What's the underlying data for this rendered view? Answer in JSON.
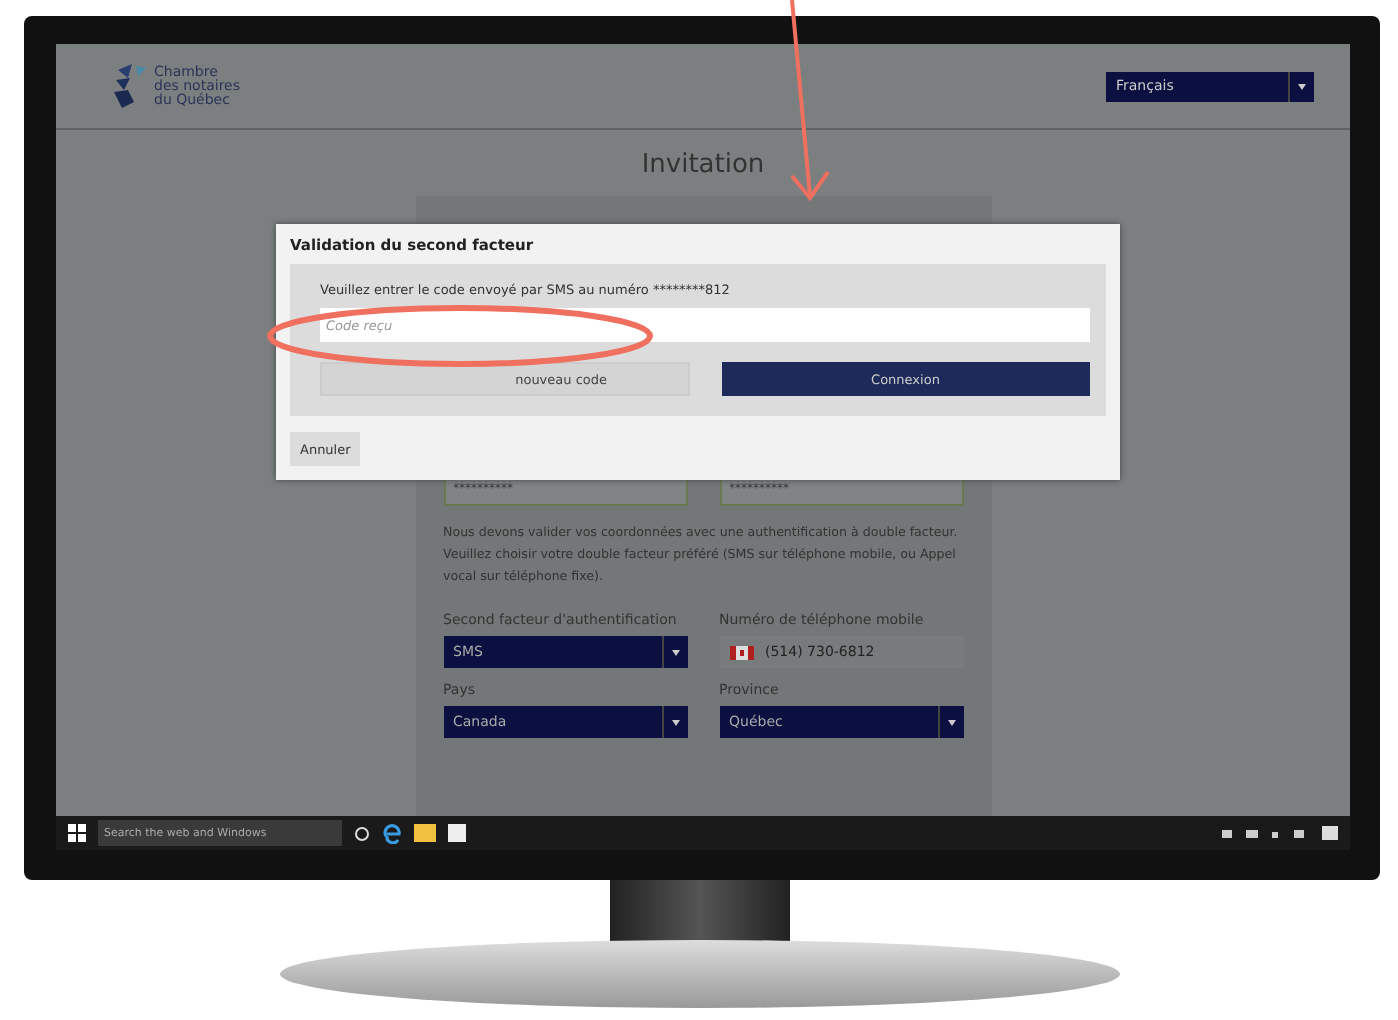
{
  "header": {
    "logo_lines": [
      "Chambre",
      "des notaires",
      "du Québec"
    ],
    "language": "Français"
  },
  "title": "Invitation",
  "form": {
    "passwords": [
      "**********",
      "**********"
    ],
    "notice": "Nous devons valider vos coordonnées avec une authentification à double facteur. Veuillez choisir votre double facteur préféré (SMS sur téléphone mobile, ou Appel vocal sur téléphone fixe).",
    "fields": [
      {
        "label": "Second facteur d'authentification",
        "value": "SMS",
        "kind": "select"
      },
      {
        "label": "Numéro de téléphone mobile",
        "value": "(514) 730-6812",
        "kind": "phone"
      },
      {
        "label": "Pays",
        "value": "Canada",
        "kind": "select"
      },
      {
        "label": "Province",
        "value": "Québec",
        "kind": "select"
      }
    ]
  },
  "dialog": {
    "title": "Validation du second facteur",
    "instruction": "Veuillez entrer le code envoyé par SMS au numéro ********812",
    "code_placeholder": "Code reçu",
    "resend_button": "nouveau code",
    "connect_button": "Connexion",
    "cancel_button": "Annuler"
  },
  "taskbar": {
    "search_placeholder": "Search the web and Windows"
  }
}
